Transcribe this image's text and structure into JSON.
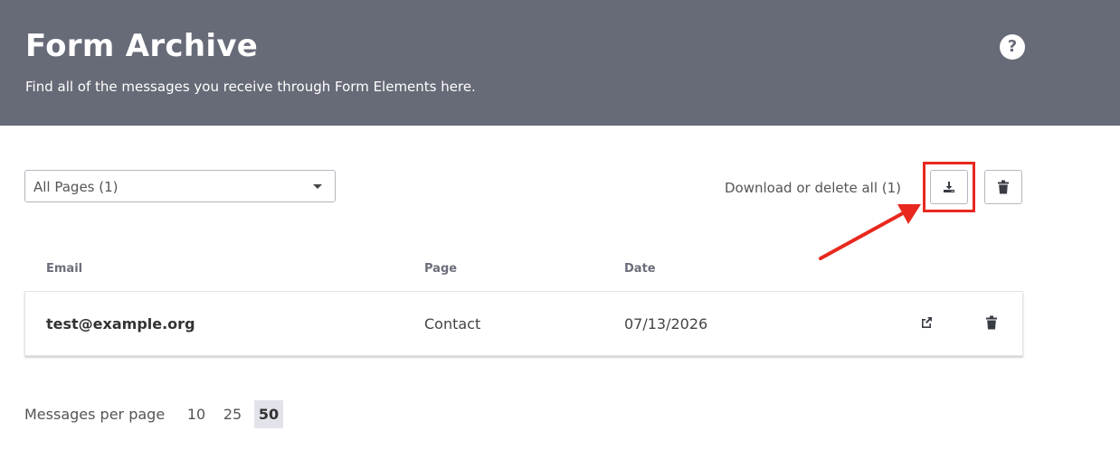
{
  "header": {
    "title": "Form Archive",
    "subtitle": "Find all of the messages you receive through Form Elements here.",
    "help_icon": "?"
  },
  "filter": {
    "selected": "All Pages (1)"
  },
  "bulk_actions": {
    "label": "Download or delete all (1)",
    "download_icon": "download-icon",
    "delete_icon": "trash-icon"
  },
  "table": {
    "columns": [
      "Email",
      "Page",
      "Date"
    ],
    "rows": [
      {
        "email": "test@example.org",
        "page": "Contact",
        "date": "07/13/2026"
      }
    ]
  },
  "pagination": {
    "label": "Messages per page",
    "options": [
      "10",
      "25",
      "50"
    ],
    "selected": "50"
  },
  "colors": {
    "header_bg": "#676a77",
    "highlight": "#e8281e",
    "selected_option_bg": "#e2e3ea"
  }
}
